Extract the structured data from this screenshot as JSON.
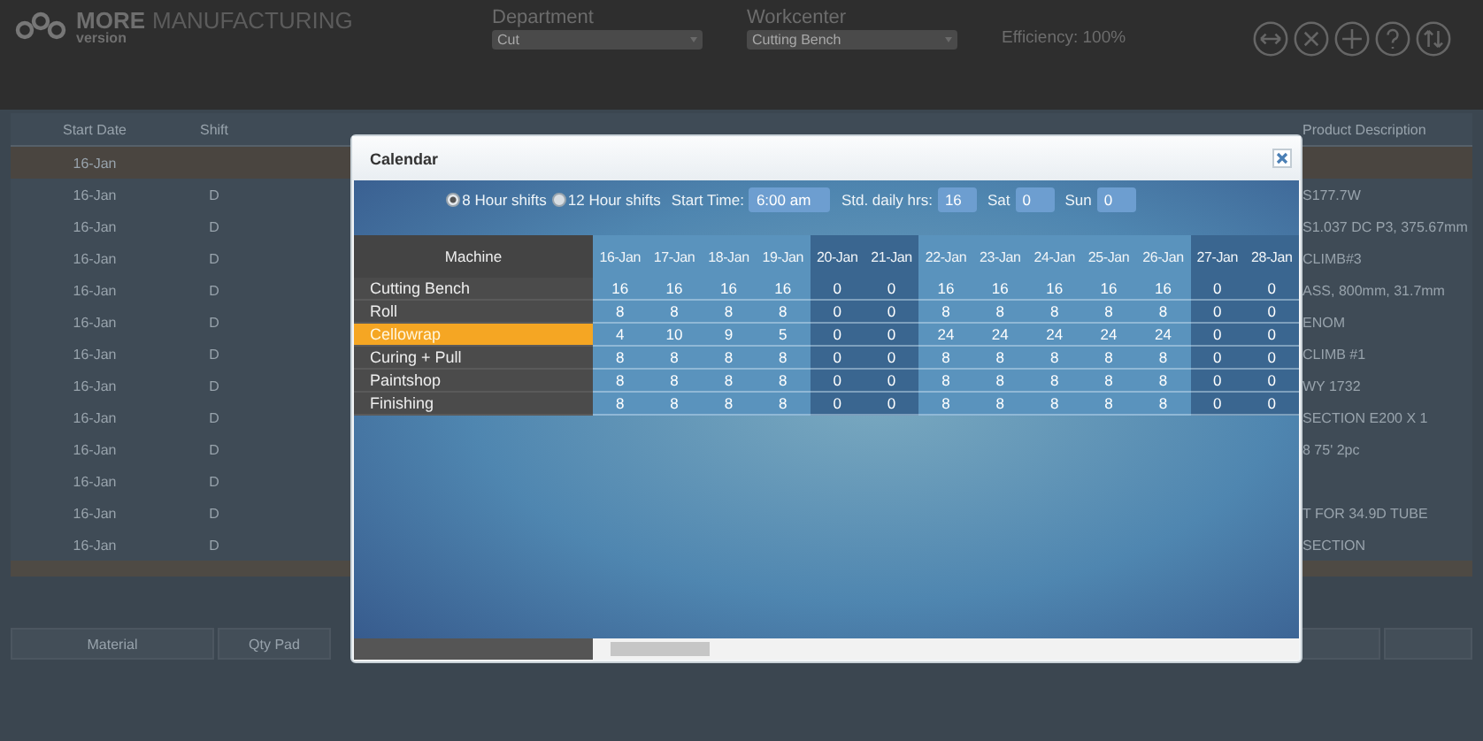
{
  "header": {
    "brand": "MORE",
    "brand_rest": "MANUFACTURING",
    "version": "version",
    "department": {
      "label": "Department",
      "value": "Cut"
    },
    "workcenter": {
      "label": "Workcenter",
      "value": "Cutting Bench"
    },
    "efficiency": "Efficiency: 100%"
  },
  "background_table": {
    "columns": [
      {
        "label": "Start Date"
      },
      {
        "label": "Shift"
      },
      {
        "label": "Product Description"
      }
    ],
    "rows": [
      {
        "start_date": "16-Jan",
        "shift": "",
        "description": "",
        "selected": true
      },
      {
        "start_date": "16-Jan",
        "shift": "D",
        "description": "S177.7W",
        "selected": false
      },
      {
        "start_date": "16-Jan",
        "shift": "D",
        "description": "S1.037 DC P3, 375.67mm",
        "selected": false
      },
      {
        "start_date": "16-Jan",
        "shift": "D",
        "description": "CLIMB#3",
        "selected": false
      },
      {
        "start_date": "16-Jan",
        "shift": "D",
        "description": "ASS, 800mm, 31.7mm",
        "selected": false
      },
      {
        "start_date": "16-Jan",
        "shift": "D",
        "description": "ENOM",
        "selected": false
      },
      {
        "start_date": "16-Jan",
        "shift": "D",
        "description": "CLIMB #1",
        "selected": false
      },
      {
        "start_date": "16-Jan",
        "shift": "D",
        "description": "WY 1732",
        "selected": false
      },
      {
        "start_date": "16-Jan",
        "shift": "D",
        "description": "SECTION E200 X 1",
        "selected": false
      },
      {
        "start_date": "16-Jan",
        "shift": "D",
        "description": "8 75' 2pc",
        "selected": false
      },
      {
        "start_date": "16-Jan",
        "shift": "D",
        "description": "",
        "selected": false
      },
      {
        "start_date": "16-Jan",
        "shift": "D",
        "description": "T FOR 34.9D TUBE",
        "selected": false
      },
      {
        "start_date": "16-Jan",
        "shift": "D",
        "description": "SECTION",
        "selected": false
      }
    ]
  },
  "bottom_buttons": [
    "Material",
    "Qty Pad"
  ],
  "dialog": {
    "title": "Calendar",
    "shift_options": [
      {
        "label": "8 Hour shifts",
        "selected": true
      },
      {
        "label": "12 Hour shifts",
        "selected": false
      }
    ],
    "start_time": {
      "label": "Start Time:",
      "value": "6:00 am"
    },
    "std_hours": {
      "label": "Std. daily hrs:",
      "value": "16"
    },
    "sat": {
      "label": "Sat",
      "value": "0"
    },
    "sun": {
      "label": "Sun",
      "value": "0"
    },
    "machine_header": "Machine",
    "dates": [
      {
        "label": "16-Jan",
        "disabled": false
      },
      {
        "label": "17-Jan",
        "disabled": false
      },
      {
        "label": "18-Jan",
        "disabled": false
      },
      {
        "label": "19-Jan",
        "disabled": false
      },
      {
        "label": "20-Jan",
        "disabled": true
      },
      {
        "label": "21-Jan",
        "disabled": true
      },
      {
        "label": "22-Jan",
        "disabled": false
      },
      {
        "label": "23-Jan",
        "disabled": false
      },
      {
        "label": "24-Jan",
        "disabled": false
      },
      {
        "label": "25-Jan",
        "disabled": false
      },
      {
        "label": "26-Jan",
        "disabled": false
      },
      {
        "label": "27-Jan",
        "disabled": true
      },
      {
        "label": "28-Jan",
        "disabled": true
      }
    ],
    "rows": [
      {
        "machine": "Cutting Bench",
        "selected": false,
        "hours": [
          "16",
          "16",
          "16",
          "16",
          "0",
          "0",
          "16",
          "16",
          "16",
          "16",
          "16",
          "0",
          "0"
        ]
      },
      {
        "machine": "Roll",
        "selected": false,
        "hours": [
          "8",
          "8",
          "8",
          "8",
          "0",
          "0",
          "8",
          "8",
          "8",
          "8",
          "8",
          "0",
          "0"
        ]
      },
      {
        "machine": "Cellowrap",
        "selected": true,
        "hours": [
          "4",
          "10",
          "9",
          "5",
          "0",
          "0",
          "24",
          "24",
          "24",
          "24",
          "24",
          "0",
          "0"
        ]
      },
      {
        "machine": "Curing + Pull",
        "selected": false,
        "hours": [
          "8",
          "8",
          "8",
          "8",
          "0",
          "0",
          "8",
          "8",
          "8",
          "8",
          "8",
          "0",
          "0"
        ]
      },
      {
        "machine": "Paintshop",
        "selected": false,
        "hours": [
          "8",
          "8",
          "8",
          "8",
          "0",
          "0",
          "8",
          "8",
          "8",
          "8",
          "8",
          "0",
          "0"
        ]
      },
      {
        "machine": "Finishing",
        "selected": false,
        "hours": [
          "8",
          "8",
          "8",
          "8",
          "0",
          "0",
          "8",
          "8",
          "8",
          "8",
          "8",
          "0",
          "0"
        ]
      }
    ]
  }
}
